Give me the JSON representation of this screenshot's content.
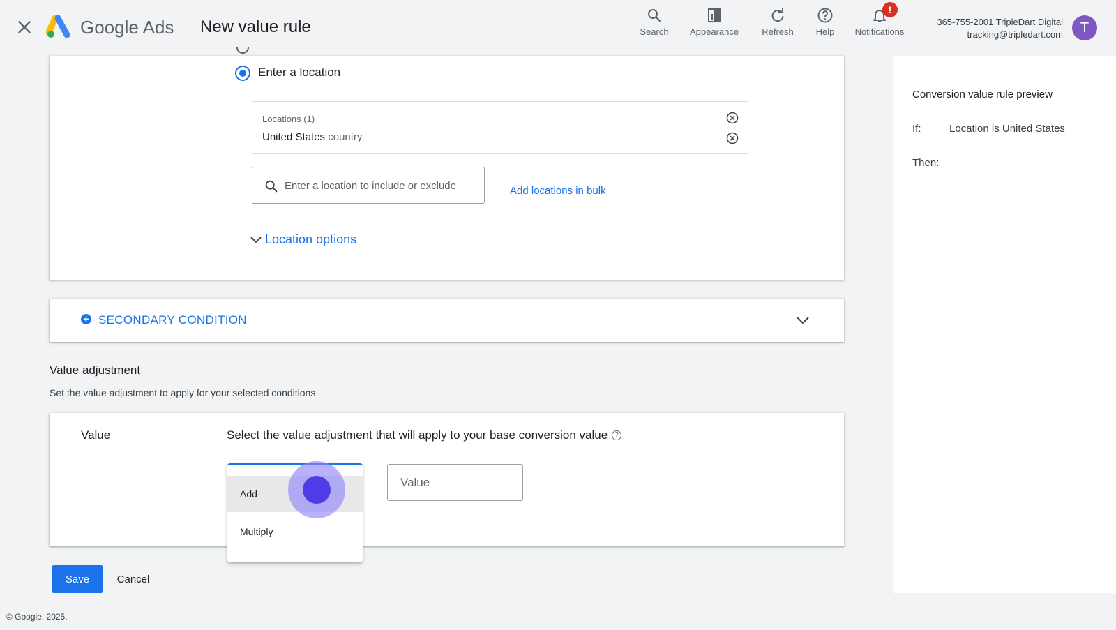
{
  "header": {
    "brand": "Google Ads",
    "page_title": "New value rule",
    "tools": [
      {
        "label": "Search",
        "icon": "search-icon"
      },
      {
        "label": "Appearance",
        "icon": "appearance-icon"
      },
      {
        "label": "Refresh",
        "icon": "refresh-icon"
      },
      {
        "label": "Help",
        "icon": "help-icon"
      },
      {
        "label": "Notifications",
        "icon": "bell-icon",
        "badge": "!"
      }
    ],
    "account": {
      "line1": "365-755-2001 TripleDart Digital",
      "line2": "tracking@tripledart.com",
      "avatar_letter": "T",
      "avatar_color": "#7e57c2"
    }
  },
  "location": {
    "radio_label": "Enter a location",
    "locations_header": "Locations (1)",
    "selected_name": "United States",
    "selected_type": "country",
    "search_placeholder": "Enter a location to include or exclude",
    "bulk_link": "Add locations in bulk",
    "options_link": "Location options"
  },
  "secondary_condition": {
    "label": "SECONDARY CONDITION"
  },
  "value_adjustment": {
    "heading": "Value adjustment",
    "subtitle": "Set the value adjustment to apply for your selected conditions",
    "row_label": "Value",
    "description": "Select the value adjustment that will apply to your base conversion value",
    "value_placeholder": "Value",
    "dropdown_options": [
      "Add",
      "Multiply"
    ],
    "hovered_option": "Add"
  },
  "actions": {
    "save": "Save",
    "cancel": "Cancel"
  },
  "footer": "© Google, 2025.",
  "preview": {
    "title": "Conversion value rule preview",
    "if_label": "If:",
    "if_value": "Location is United States",
    "then_label": "Then:"
  },
  "colors": {
    "accent": "#1a73e8",
    "badge": "#d93025",
    "background": "#f1f3f4"
  }
}
